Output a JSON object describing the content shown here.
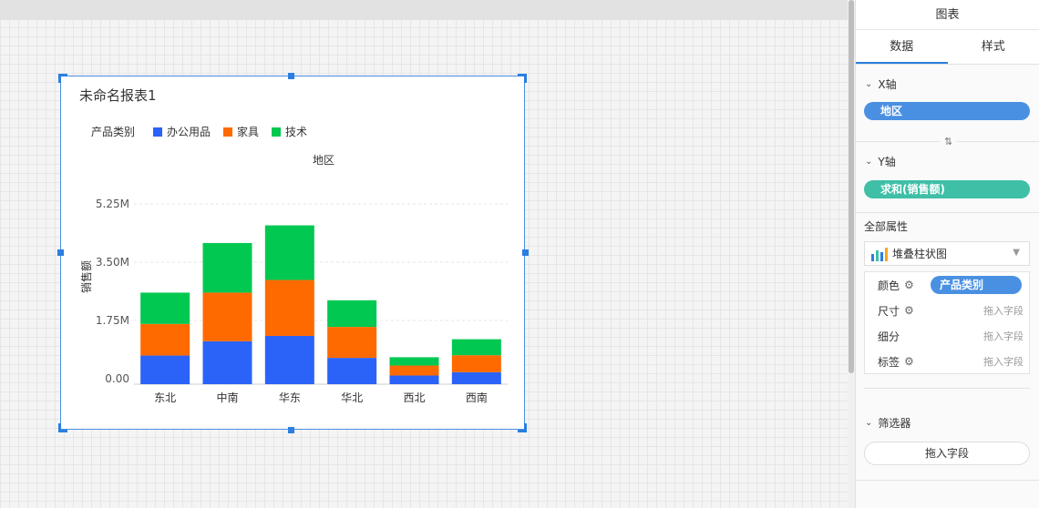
{
  "widget": {
    "title": "未命名报表1"
  },
  "legend": {
    "label": "产品类别",
    "items": [
      {
        "label": "办公用品",
        "color": "#2b63f8"
      },
      {
        "label": "家具",
        "color": "#ff6a00"
      },
      {
        "label": "技术",
        "color": "#00c851"
      }
    ]
  },
  "chart_data": {
    "type": "bar",
    "stacked": true,
    "title": "",
    "xlabel": "地区",
    "ylabel": "销售额",
    "categories": [
      "东北",
      "中南",
      "华东",
      "华北",
      "西北",
      "西南"
    ],
    "yticks": [
      "0.00",
      "1.75M",
      "3.50M",
      "5.25M"
    ],
    "ylim": [
      0,
      5.25
    ],
    "series": [
      {
        "name": "办公用品",
        "color": "#2b63f8",
        "values": [
          0.86,
          1.29,
          1.45,
          0.79,
          0.26,
          0.36
        ]
      },
      {
        "name": "家具",
        "color": "#ff6a00",
        "values": [
          0.95,
          1.46,
          1.68,
          0.93,
          0.3,
          0.51
        ]
      },
      {
        "name": "技术",
        "color": "#00c851",
        "values": [
          0.94,
          1.49,
          1.64,
          0.8,
          0.25,
          0.48
        ]
      }
    ],
    "grid": true,
    "legend_position": "top-left"
  },
  "panel": {
    "header": "图表",
    "tabs": [
      "数据",
      "样式"
    ],
    "x_axis": {
      "title": "X轴",
      "field": "地区",
      "field_color": "#4a90e2"
    },
    "y_axis": {
      "title": "Y轴",
      "field": "求和(销售额)",
      "field_color": "#3fbfa6"
    },
    "all_props": "全部属性",
    "chart_type": "堆叠柱状图",
    "attrs": [
      {
        "name": "颜色",
        "value": "产品类别",
        "value_color": "#4a90e2"
      },
      {
        "name": "尺寸",
        "value": "拖入字段"
      },
      {
        "name": "细分",
        "value": "拖入字段"
      },
      {
        "name": "标签",
        "value": "拖入字段"
      }
    ],
    "filter": {
      "title": "筛选器",
      "button": "拖入字段"
    }
  }
}
